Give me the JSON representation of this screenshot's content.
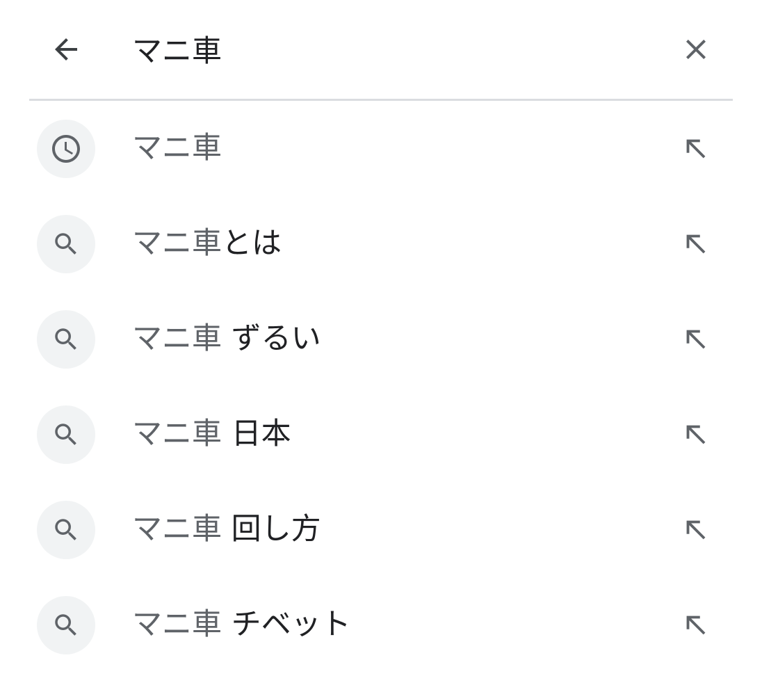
{
  "search": {
    "query": "マニ車",
    "back_icon": "arrow-back-icon",
    "clear_icon": "close-icon"
  },
  "colors": {
    "prefix_text": "#5f6368",
    "suffix_text": "#202124",
    "icon_bg": "#f1f3f4",
    "icon": "#5f6368",
    "divider": "#dadce0"
  },
  "suggestions": [
    {
      "type": "history",
      "icon": "history-clock-icon",
      "prefix": "マニ車",
      "suffix": "",
      "fill_icon": "arrow-up-left-icon"
    },
    {
      "type": "search",
      "icon": "search-icon",
      "prefix": "マニ車",
      "suffix": "とは",
      "fill_icon": "arrow-up-left-icon"
    },
    {
      "type": "search",
      "icon": "search-icon",
      "prefix": "マニ車",
      "suffix": " ずるい",
      "fill_icon": "arrow-up-left-icon"
    },
    {
      "type": "search",
      "icon": "search-icon",
      "prefix": "マニ車",
      "suffix": " 日本",
      "fill_icon": "arrow-up-left-icon"
    },
    {
      "type": "search",
      "icon": "search-icon",
      "prefix": "マニ車",
      "suffix": " 回し方",
      "fill_icon": "arrow-up-left-icon"
    },
    {
      "type": "search",
      "icon": "search-icon",
      "prefix": "マニ車",
      "suffix": " チベット",
      "fill_icon": "arrow-up-left-icon"
    }
  ]
}
